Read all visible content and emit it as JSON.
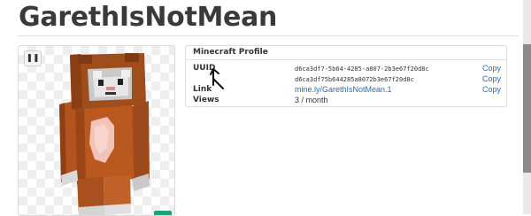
{
  "page": {
    "title": "GarethIsNotMean"
  },
  "skin_viewer": {
    "pause_icon": "pause-icon",
    "pause_glyph": "❚❚"
  },
  "profile": {
    "header": "Minecraft Profile",
    "uuid_label": "UUID",
    "uuid_dashed": "d6ca3df7-5b64-4285-a807-2b3e67f20d8c",
    "uuid_plain": "d6ca3df75b644285a8072b3e67f20d8c",
    "link_label": "Link",
    "link_value": "mine.ly/GarethIsNotMean.1",
    "views_label": "Views",
    "views_value": "3 / month",
    "copy_label": "Copy"
  },
  "colors": {
    "link": "#2b6cb0",
    "accent_green": "#1aa37a"
  }
}
